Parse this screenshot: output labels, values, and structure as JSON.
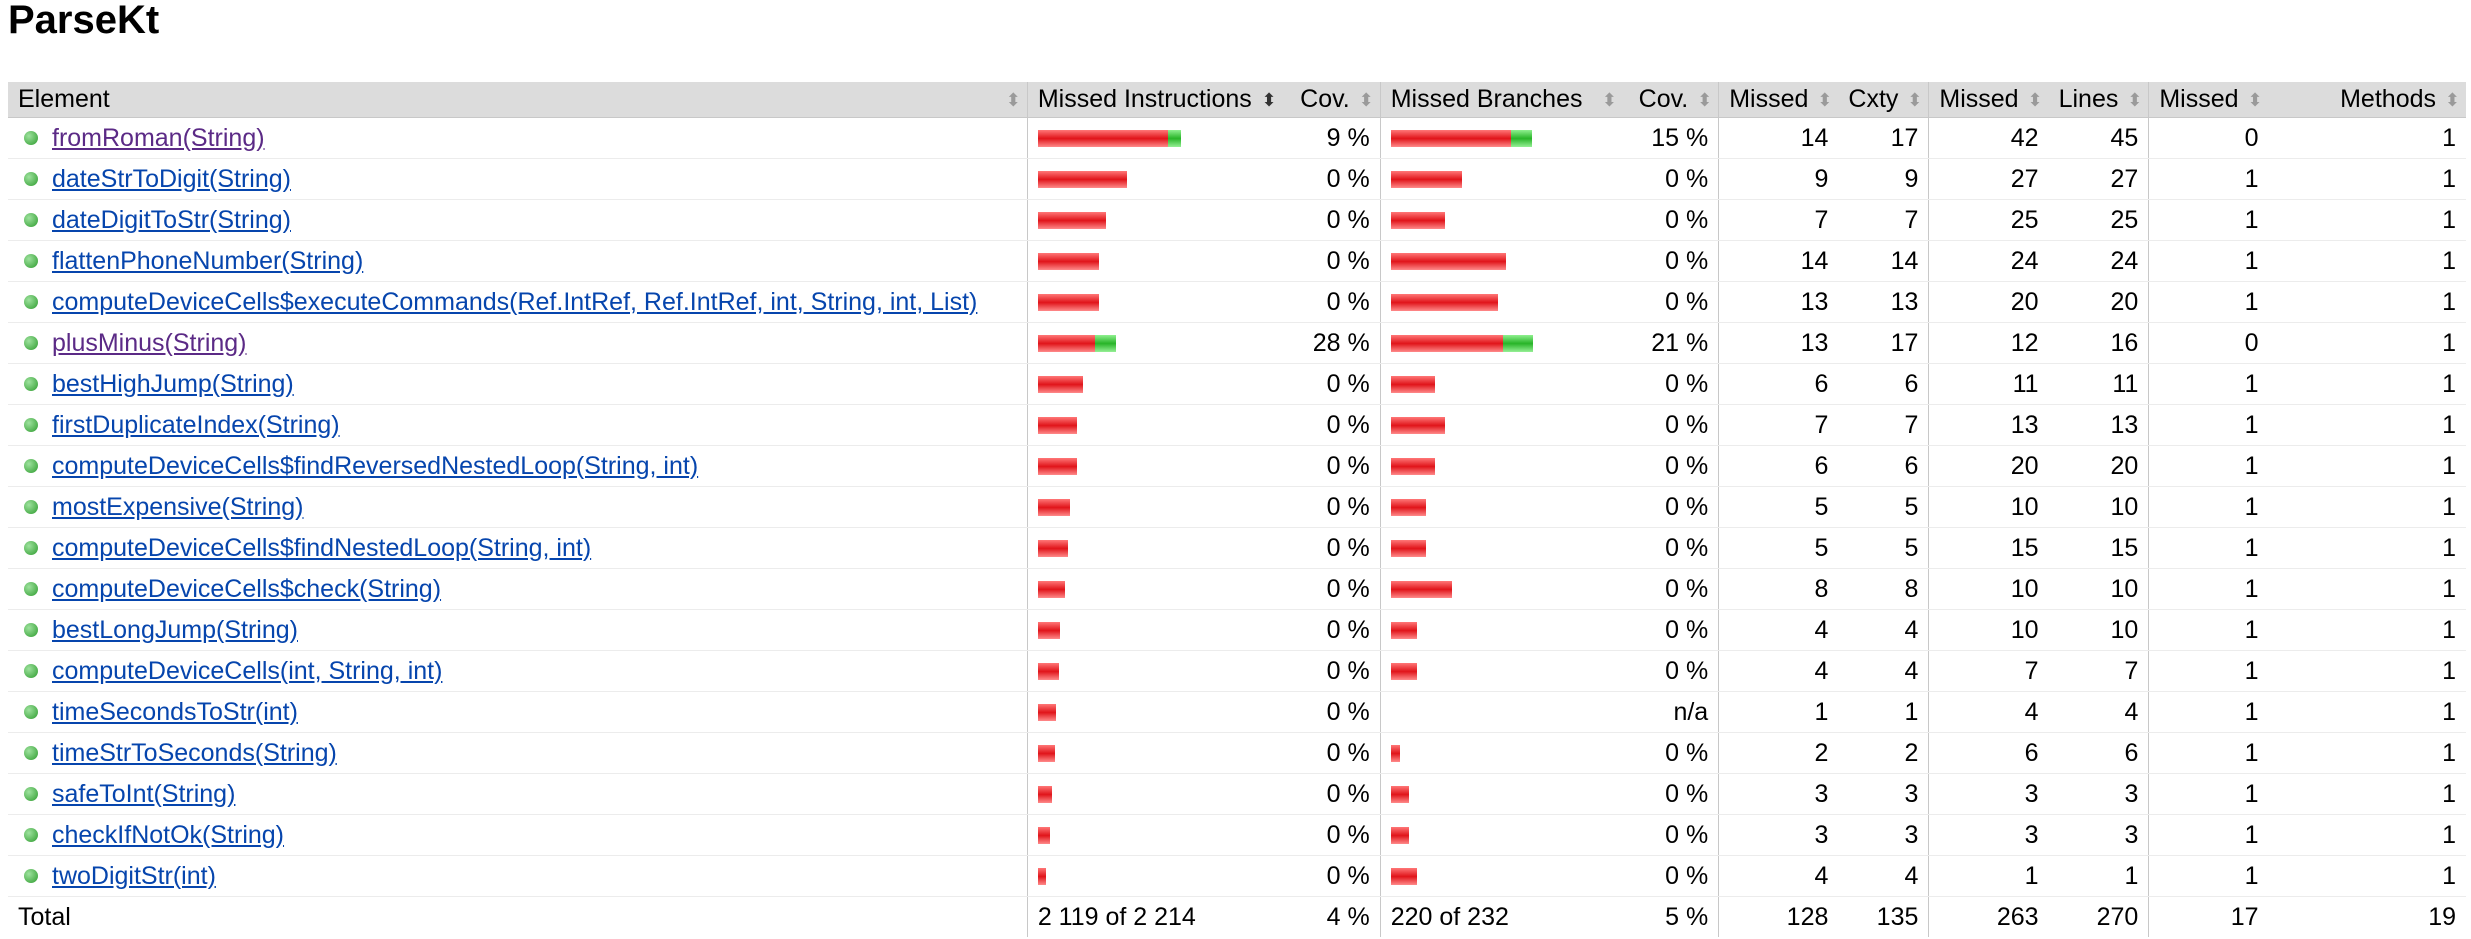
{
  "title": "ParseKt",
  "headers": {
    "element": "Element",
    "missed_instructions": "Missed Instructions",
    "instr_cov": "Cov.",
    "missed_branches": "Missed Branches",
    "branch_cov": "Cov.",
    "cxty_missed": "Missed",
    "cxty": "Cxty",
    "lines_missed": "Missed",
    "lines": "Lines",
    "methods_missed": "Missed",
    "methods": "Methods"
  },
  "colors": {
    "missed_bar": "#e0141a",
    "covered_bar": "#28b428",
    "header_bg": "#dcdcdc",
    "link": "#0645ad",
    "visited_link": "#5b2a86"
  },
  "rows": [
    {
      "name": "fromRoman(String)",
      "visited": true,
      "instr_missed_frac": 0.6167,
      "instr_covered_frac": 0.0628,
      "instr_cov": "9 %",
      "br_missed_frac": 0.5714,
      "br_covered_frac": 0.1,
      "br_cov": "15 %",
      "cxty_missed": "14",
      "cxty": "17",
      "lines_missed": "42",
      "lines": "45",
      "methods_missed": "0",
      "methods": "1"
    },
    {
      "name": "dateStrToDigit(String)",
      "visited": false,
      "instr_missed_frac": 0.4258,
      "instr_covered_frac": 0,
      "instr_cov": "0 %",
      "br_missed_frac": 0.3381,
      "br_covered_frac": 0,
      "br_cov": "0 %",
      "cxty_missed": "9",
      "cxty": "9",
      "lines_missed": "27",
      "lines": "27",
      "methods_missed": "1",
      "methods": "1"
    },
    {
      "name": "dateDigitToStr(String)",
      "visited": false,
      "instr_missed_frac": 0.3223,
      "instr_covered_frac": 0,
      "instr_cov": "0 %",
      "br_missed_frac": 0.2571,
      "br_covered_frac": 0,
      "br_cov": "0 %",
      "cxty_missed": "7",
      "cxty": "7",
      "lines_missed": "25",
      "lines": "25",
      "methods_missed": "1",
      "methods": "1"
    },
    {
      "name": "flattenPhoneNumber(String)",
      "visited": false,
      "instr_missed_frac": 0.2907,
      "instr_covered_frac": 0,
      "instr_cov": "0 %",
      "br_missed_frac": 0.5476,
      "br_covered_frac": 0,
      "br_cov": "0 %",
      "cxty_missed": "14",
      "cxty": "14",
      "lines_missed": "24",
      "lines": "24",
      "methods_missed": "1",
      "methods": "1"
    },
    {
      "name": "computeDeviceCells$executeCommands(Ref.IntRef, Ref.IntRef, int, String, int, List)",
      "visited": false,
      "instr_missed_frac": 0.2907,
      "instr_covered_frac": 0,
      "instr_cov": "0 %",
      "br_missed_frac": 0.5095,
      "br_covered_frac": 0,
      "br_cov": "0 %",
      "cxty_missed": "13",
      "cxty": "13",
      "lines_missed": "20",
      "lines": "20",
      "methods_missed": "1",
      "methods": "1"
    },
    {
      "name": "plusMinus(String)",
      "visited": true,
      "instr_missed_frac": 0.2697,
      "instr_covered_frac": 0.1003,
      "instr_cov": "28 %",
      "br_missed_frac": 0.5333,
      "br_covered_frac": 0.1429,
      "br_cov": "21 %",
      "cxty_missed": "13",
      "cxty": "17",
      "lines_missed": "12",
      "lines": "16",
      "methods_missed": "0",
      "methods": "1"
    },
    {
      "name": "bestHighJump(String)",
      "visited": false,
      "instr_missed_frac": 0.2157,
      "instr_covered_frac": 0,
      "instr_cov": "0 %",
      "br_missed_frac": 0.2095,
      "br_covered_frac": 0,
      "br_cov": "0 %",
      "cxty_missed": "6",
      "cxty": "6",
      "lines_missed": "11",
      "lines": "11",
      "methods_missed": "1",
      "methods": "1"
    },
    {
      "name": "firstDuplicateIndex(String)",
      "visited": false,
      "instr_missed_frac": 0.1845,
      "instr_covered_frac": 0,
      "instr_cov": "0 %",
      "br_missed_frac": 0.2571,
      "br_covered_frac": 0,
      "br_cov": "0 %",
      "cxty_missed": "7",
      "cxty": "7",
      "lines_missed": "13",
      "lines": "13",
      "methods_missed": "1",
      "methods": "1"
    },
    {
      "name": "computeDeviceCells$findReversedNestedLoop(String, int)",
      "visited": false,
      "instr_missed_frac": 0.1845,
      "instr_covered_frac": 0,
      "instr_cov": "0 %",
      "br_missed_frac": 0.2095,
      "br_covered_frac": 0,
      "br_cov": "0 %",
      "cxty_missed": "6",
      "cxty": "6",
      "lines_missed": "20",
      "lines": "20",
      "methods_missed": "1",
      "methods": "1"
    },
    {
      "name": "mostExpensive(String)",
      "visited": false,
      "instr_missed_frac": 0.1545,
      "instr_covered_frac": 0,
      "instr_cov": "0 %",
      "br_missed_frac": 0.1667,
      "br_covered_frac": 0,
      "br_cov": "0 %",
      "cxty_missed": "5",
      "cxty": "5",
      "lines_missed": "10",
      "lines": "10",
      "methods_missed": "1",
      "methods": "1"
    },
    {
      "name": "computeDeviceCells$findNestedLoop(String, int)",
      "visited": false,
      "instr_missed_frac": 0.1425,
      "instr_covered_frac": 0,
      "instr_cov": "0 %",
      "br_missed_frac": 0.1667,
      "br_covered_frac": 0,
      "br_cov": "0 %",
      "cxty_missed": "5",
      "cxty": "5",
      "lines_missed": "15",
      "lines": "15",
      "methods_missed": "1",
      "methods": "1"
    },
    {
      "name": "computeDeviceCells$check(String)",
      "visited": false,
      "instr_missed_frac": 0.1305,
      "instr_covered_frac": 0,
      "instr_cov": "0 %",
      "br_missed_frac": 0.2905,
      "br_covered_frac": 0,
      "br_cov": "0 %",
      "cxty_missed": "8",
      "cxty": "8",
      "lines_missed": "10",
      "lines": "10",
      "methods_missed": "1",
      "methods": "1"
    },
    {
      "name": "bestLongJump(String)",
      "visited": false,
      "instr_missed_frac": 0.1065,
      "instr_covered_frac": 0,
      "instr_cov": "0 %",
      "br_missed_frac": 0.1238,
      "br_covered_frac": 0,
      "br_cov": "0 %",
      "cxty_missed": "4",
      "cxty": "4",
      "lines_missed": "10",
      "lines": "10",
      "methods_missed": "1",
      "methods": "1"
    },
    {
      "name": "computeDeviceCells(int, String, int)",
      "visited": false,
      "instr_missed_frac": 0.1005,
      "instr_covered_frac": 0,
      "instr_cov": "0 %",
      "br_missed_frac": 0.1238,
      "br_covered_frac": 0,
      "br_cov": "0 %",
      "cxty_missed": "4",
      "cxty": "4",
      "lines_missed": "7",
      "lines": "7",
      "methods_missed": "1",
      "methods": "1"
    },
    {
      "name": "timeSecondsToStr(int)",
      "visited": false,
      "instr_missed_frac": 0.0855,
      "instr_covered_frac": 0,
      "instr_cov": "0 %",
      "br_missed_frac": 0,
      "br_covered_frac": 0,
      "br_cov": "n/a",
      "cxty_missed": "1",
      "cxty": "1",
      "lines_missed": "4",
      "lines": "4",
      "methods_missed": "1",
      "methods": "1"
    },
    {
      "name": "timeStrToSeconds(String)",
      "visited": false,
      "instr_missed_frac": 0.0795,
      "instr_covered_frac": 0,
      "instr_cov": "0 %",
      "br_missed_frac": 0.0429,
      "br_covered_frac": 0,
      "br_cov": "0 %",
      "cxty_missed": "2",
      "cxty": "2",
      "lines_missed": "6",
      "lines": "6",
      "methods_missed": "1",
      "methods": "1"
    },
    {
      "name": "safeToInt(String)",
      "visited": false,
      "instr_missed_frac": 0.0675,
      "instr_covered_frac": 0,
      "instr_cov": "0 %",
      "br_missed_frac": 0.0857,
      "br_covered_frac": 0,
      "br_cov": "0 %",
      "cxty_missed": "3",
      "cxty": "3",
      "lines_missed": "3",
      "lines": "3",
      "methods_missed": "1",
      "methods": "1"
    },
    {
      "name": "checkIfNotOk(String)",
      "visited": false,
      "instr_missed_frac": 0.0555,
      "instr_covered_frac": 0,
      "instr_cov": "0 %",
      "br_missed_frac": 0.0857,
      "br_covered_frac": 0,
      "br_cov": "0 %",
      "cxty_missed": "3",
      "cxty": "3",
      "lines_missed": "3",
      "lines": "3",
      "methods_missed": "1",
      "methods": "1"
    },
    {
      "name": "twoDigitStr(int)",
      "visited": false,
      "instr_missed_frac": 0.0375,
      "instr_covered_frac": 0,
      "instr_cov": "0 %",
      "br_missed_frac": 0.1238,
      "br_covered_frac": 0,
      "br_cov": "0 %",
      "cxty_missed": "4",
      "cxty": "4",
      "lines_missed": "1",
      "lines": "1",
      "methods_missed": "1",
      "methods": "1"
    }
  ],
  "total": {
    "label": "Total",
    "instructions": "2 119 of 2 214",
    "instr_cov": "4 %",
    "branches": "220 of 232",
    "branch_cov": "5 %",
    "cxty_missed": "128",
    "cxty": "135",
    "lines_missed": "263",
    "lines": "270",
    "methods_missed": "17",
    "methods": "19"
  }
}
